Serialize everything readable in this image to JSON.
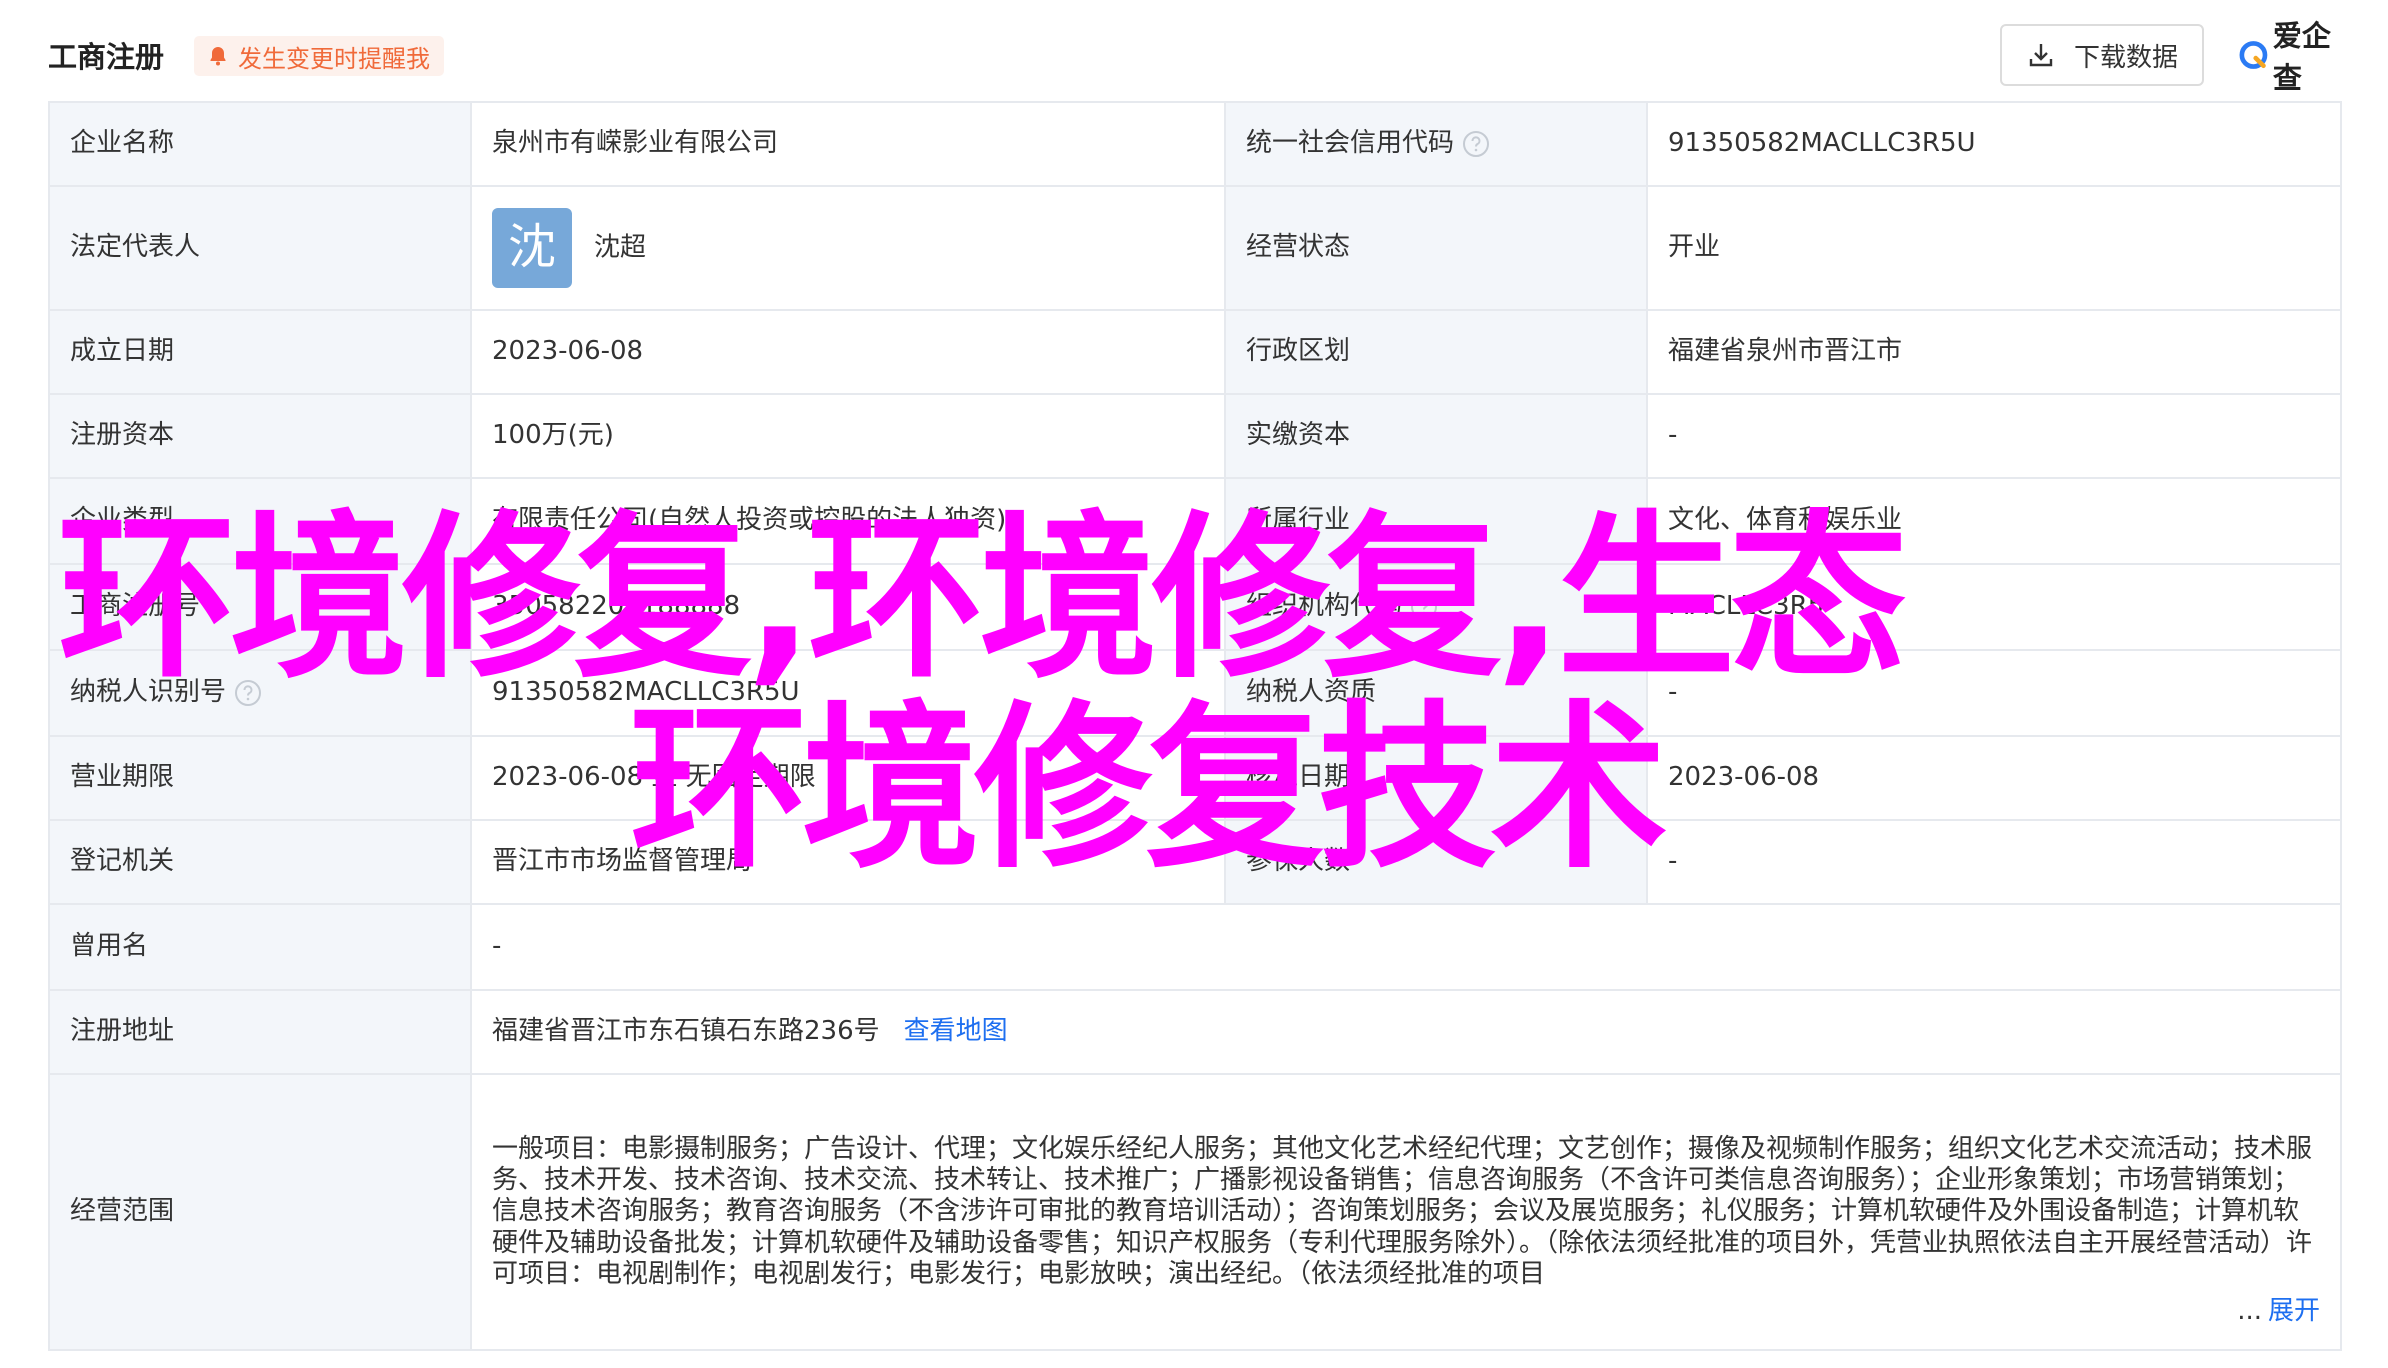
{
  "header": {
    "title": "工商注册",
    "notify_label": "发生变更时提醒我",
    "download_label": "下载数据",
    "logo_text": "爱企查"
  },
  "rows": [
    {
      "l1": "企业名称",
      "v1": "泉州市有嵘影业有限公司",
      "l2": "统一社会信用代码",
      "v2": "91350582MACLLC3R5U"
    },
    {
      "l1": "法定代表人",
      "avatar": "沈",
      "v1": "沈超",
      "l2": "经营状态",
      "v2": "开业"
    },
    {
      "l1": "成立日期",
      "v1": "2023-06-08",
      "l2": "行政区划",
      "v2": "福建省泉州市晋江市"
    },
    {
      "l1": "注册资本",
      "v1": "100万(元)",
      "l2": "实缴资本",
      "v2": "-"
    },
    {
      "l1": "企业类型",
      "v1": "有限责任公司(自然人投资或控股的法人独资)",
      "l2": "所属行业",
      "v2": "文化、体育和娱乐业"
    },
    {
      "l1": "工商注册号",
      "v1": "350582201188888",
      "l2": "组织机构代码",
      "v2": "MACLLC3R5"
    },
    {
      "l1": "纳税人识别号",
      "v1": "91350582MACLLC3R5U",
      "l2": "纳税人资质",
      "v2": "-"
    },
    {
      "l1": "营业期限",
      "v1": "2023-06-08 至 无固定期限",
      "l2": "核准日期",
      "v2": "2023-06-08"
    },
    {
      "l1": "登记机关",
      "v1": "晋江市市场监督管理局",
      "l2": "参保人数",
      "v2": "-"
    },
    {
      "l1": "曾用名",
      "v1": "-"
    },
    {
      "l1": "注册地址",
      "v1": "福建省晋江市东石镇石东路236号",
      "link": "查看地图"
    },
    {
      "l1": "经营范围",
      "v1": "一般项目：电影摄制服务；广告设计、代理；文化娱乐经纪人服务；其他文化艺术经纪代理；文艺创作；摄像及视频制作服务；组织文化艺术交流活动；技术服务、技术开发、技术咨询、技术交流、技术转让、技术推广；广播影视设备销售；信息咨询服务（不含许可类信息咨询服务）；企业形象策划；市场营销策划；信息技术咨询服务；教育咨询服务（不含涉许可审批的教育培训活动）；咨询策划服务；会议及展览服务；礼仪服务；计算机软硬件及外围设备制造；计算机软硬件及辅助设备批发；计算机软硬件及辅助设备零售；知识产权服务（专利代理服务除外）。（除依法须经批准的项目外，凭营业执照依法自主开展经营活动）许可项目：电视剧制作；电视剧发行；电影发行；电影放映；演出经纪。（依法须经批准的项目",
      "dots": "...",
      "expand": "展开"
    }
  ],
  "overlay": {
    "line1": "环境修复,环境修复,生态",
    "line2": "环境修复技术"
  },
  "colors": {
    "accent_link": "#1e6ff0",
    "label_bg": "#f3f6fa",
    "notify_text": "#f06a3a",
    "overlay_text": "#ff00ff",
    "avatar_bg": "#77a8d9"
  }
}
